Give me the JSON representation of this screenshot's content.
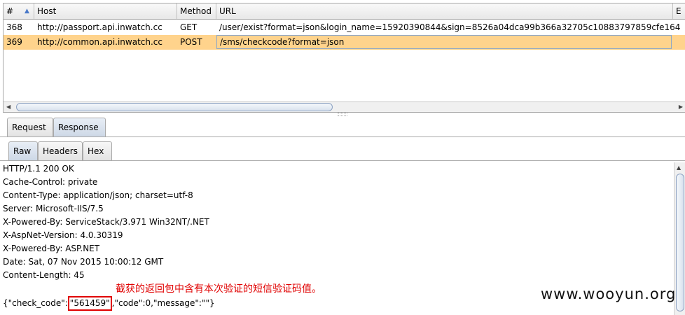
{
  "table": {
    "columns": [
      "#",
      "Host",
      "Method",
      "URL",
      "E"
    ],
    "rows": [
      {
        "num": "368",
        "host": "http://passport.api.inwatch.cc",
        "method": "GET",
        "url": "/user/exist?format=json&login_name=15920390844&sign=8526a04dca99b366a32705c10883797859cfe164"
      },
      {
        "num": "369",
        "host": "http://common.api.inwatch.cc",
        "method": "POST",
        "url": "/sms/checkcode?format=json"
      }
    ]
  },
  "tabs_top": [
    "Request",
    "Response"
  ],
  "tabs_sub": [
    "Raw",
    "Headers",
    "Hex"
  ],
  "response": {
    "lines": [
      "HTTP/1.1 200 OK",
      "Cache-Control: private",
      "Content-Type: application/json; charset=utf-8",
      "Server: Microsoft-IIS/7.5",
      "X-Powered-By: ServiceStack/3.971 Win32NT/.NET",
      "X-AspNet-Version: 4.0.30319",
      "X-Powered-By: ASP.NET",
      "Date: Sat, 07 Nov 2015 10:00:12 GMT",
      "Content-Length: 45"
    ],
    "json_prefix": "{\"check_code\":",
    "json_code": "\"561459\"",
    "json_suffix": ",\"code\":0,\"message\":\"\"}"
  },
  "annotation": "截获的返回包中含有本次验证的短信验证码值。",
  "watermark": "www.wooyun.org",
  "colors": {
    "selected_row": "#ffd38c",
    "highlight": "#e00000"
  }
}
